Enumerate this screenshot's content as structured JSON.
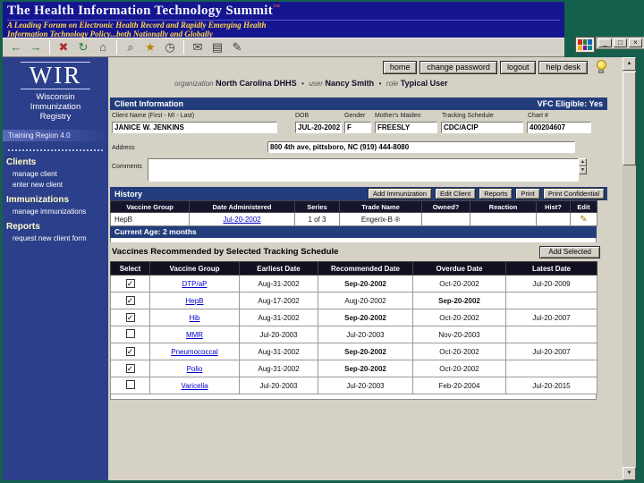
{
  "colors": {
    "slide_bg": "#14604d",
    "banner_bg": "#15158f",
    "subtitle_gold": "#ffd84d",
    "navy_bar": "#233d7c",
    "sidebar_bg": "#2c3f8a",
    "recommended_green": "#8db88a",
    "overdue_blue": "#3e9ed6",
    "link_blue": "#0000cc"
  },
  "banner": {
    "title": "The Health Information Technology Summit",
    "tm": "™",
    "sub1": "A Leading Forum on Electronic Health Record and Rapidly Emerging Health",
    "sub2": "Information Technology Policy...both Nationally and Globally"
  },
  "window_controls": {
    "minimize": "_",
    "restore": "□",
    "close": "×"
  },
  "toolbar": {
    "icons": [
      {
        "name": "back-icon",
        "glyph": "←"
      },
      {
        "name": "forward-icon",
        "glyph": "→"
      },
      {
        "name": "stop-icon",
        "glyph": "✖"
      },
      {
        "name": "refresh-icon",
        "glyph": "↻"
      },
      {
        "name": "home-icon",
        "glyph": "⌂"
      },
      {
        "name": "search-icon",
        "glyph": "⌕"
      },
      {
        "name": "favorites-icon",
        "glyph": "★"
      },
      {
        "name": "history-icon",
        "glyph": "◷"
      },
      {
        "name": "mail-icon",
        "glyph": "✉"
      },
      {
        "name": "print-icon",
        "glyph": "▤"
      },
      {
        "name": "edit-icon",
        "glyph": "✎"
      }
    ]
  },
  "topnav": {
    "items": [
      "home",
      "change password",
      "logout",
      "help desk"
    ]
  },
  "context": {
    "org_label": "organization",
    "org": "North Carolina DHHS",
    "sep": "•",
    "user_label": "user",
    "user": "Nancy Smith",
    "role_label": "role",
    "role": "Typical User"
  },
  "sidebar": {
    "logo": "WIR",
    "name_lines": [
      "Wisconsin",
      "Immunization",
      "Registry"
    ],
    "region": "Training Region 4.0",
    "sections": [
      {
        "title": "Clients",
        "items": [
          "manage client",
          "enter new client"
        ]
      },
      {
        "title": "Immunizations",
        "items": [
          "manage immunizations"
        ]
      },
      {
        "title": "Reports",
        "items": [
          "request new client form"
        ]
      }
    ]
  },
  "client": {
    "section_title": "Client Information",
    "vfc": "VFC Eligible: Yes",
    "fields": [
      {
        "label": "Client Name (First - MI - Last)",
        "value": "JANICE W. JENKINS"
      },
      {
        "label": "DOB",
        "value": "JUL-20-2002"
      },
      {
        "label": "Gender",
        "value": "F"
      },
      {
        "label": "Mother's Maiden",
        "value": "FREESLY"
      },
      {
        "label": "Tracking Schedule",
        "value": "CDC/ACIP"
      },
      {
        "label": "Chart #",
        "value": "400204607"
      }
    ],
    "address_label": "Address",
    "address": "800 4th ave, pittsboro, NC (919) 444-8080",
    "comments_label": "Comments"
  },
  "history": {
    "section_title": "History",
    "buttons": [
      "Add Immunization",
      "Edit Client",
      "Reports",
      "Print",
      "Print Confidential"
    ],
    "columns": [
      "Vaccine Group",
      "Date Administered",
      "Series",
      "Trade Name",
      "Owned?",
      "Reaction",
      "Hist?",
      "Edit"
    ],
    "rows": [
      {
        "group": "HepB",
        "date": "Jul-20-2002",
        "series": "1 of 3",
        "trade": "Engerix-B ®",
        "owned": "",
        "reaction": "",
        "hist": "",
        "edit": "✎"
      }
    ]
  },
  "age_bar": {
    "label": "Current Age: 2 months"
  },
  "recommended": {
    "section_title": "Vaccines Recommended by Selected Tracking Schedule",
    "add_button": "Add Selected",
    "columns": [
      "Select",
      "Vaccine Group",
      "Earliest Date",
      "Recommended Date",
      "Overdue Date",
      "Latest Date"
    ],
    "rows": [
      {
        "selected": "✓",
        "group": "DTP/aP",
        "earliest": "Aug-31-2002",
        "recommended": "Sep-20-2002",
        "overdue": "Oct-20-2002",
        "latest": "Jul-20-2009"
      },
      {
        "selected": "✓",
        "group": "HepB",
        "earliest": "Aug-17-2002",
        "recommended": "Aug-20-2002",
        "overdue": "Sep-20-2002",
        "latest": ""
      },
      {
        "selected": "✓",
        "group": "Hib",
        "earliest": "Aug-31-2002",
        "recommended": "Sep-20-2002",
        "overdue": "Oct-20-2002",
        "latest": "Jul-20-2007"
      },
      {
        "selected": "",
        "group": "MMR",
        "earliest": "Jul-20-2003",
        "recommended": "Jul-20-2003",
        "overdue": "Nov-20-2003",
        "latest": ""
      },
      {
        "selected": "✓",
        "group": "Pneumococcal",
        "earliest": "Aug-31-2002",
        "recommended": "Sep-20-2002",
        "overdue": "Oct-20-2002",
        "latest": "Jul-20-2007"
      },
      {
        "selected": "✓",
        "group": "Polio",
        "earliest": "Aug-31-2002",
        "recommended": "Sep-20-2002",
        "overdue": "Oct-20-2002",
        "latest": ""
      },
      {
        "selected": "",
        "group": "Varicella",
        "earliest": "Jul-20-2003",
        "recommended": "Jul-20-2003",
        "overdue": "Feb-20-2004",
        "latest": "Jul-20-2015"
      }
    ]
  },
  "scrollbar": {
    "up": "▲",
    "down": "▼"
  },
  "comments_stepper": {
    "up": "▲",
    "down": "▼"
  }
}
